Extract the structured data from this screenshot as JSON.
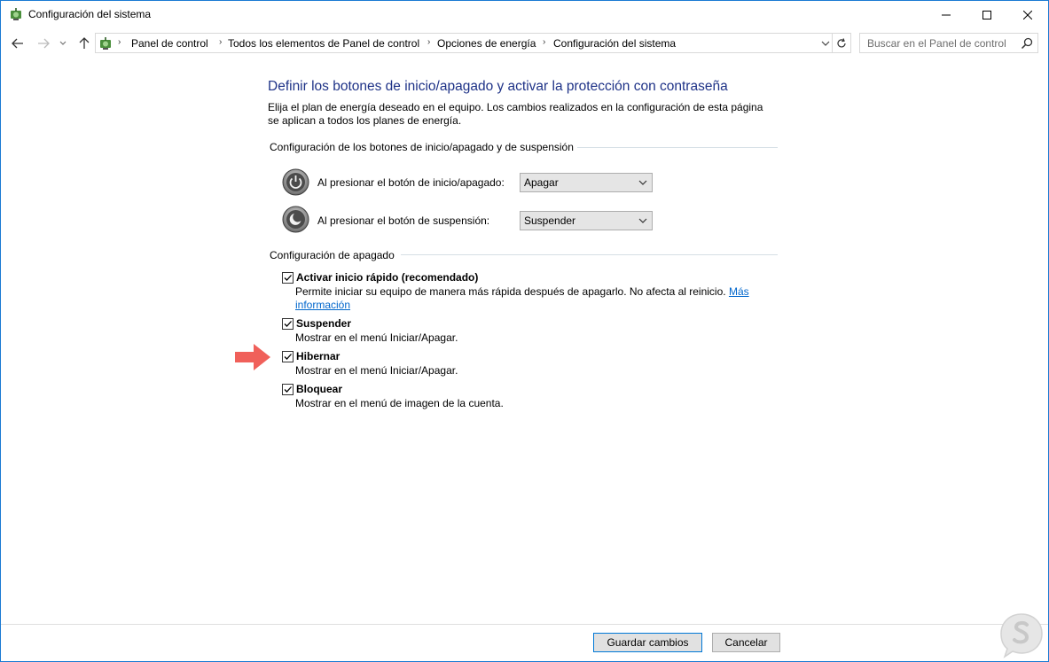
{
  "window": {
    "title": "Configuración del sistema"
  },
  "nav": {
    "breadcrumbs": [
      "Panel de control",
      "Todos los elementos de Panel de control",
      "Opciones de energía",
      "Configuración del sistema"
    ],
    "search_placeholder": "Buscar en el Panel de control"
  },
  "main": {
    "heading": "Definir los botones de inicio/apagado y activar la protección con contraseña",
    "description": "Elija el plan de energía deseado en el equipo. Los cambios realizados en la configuración de esta página se aplican a todos los planes de energía.",
    "buttons_section": {
      "title": "Configuración de los botones de inicio/apagado y de suspensión",
      "power_button_label": "Al presionar el botón de inicio/apagado:",
      "power_button_value": "Apagar",
      "sleep_button_label": "Al presionar el botón de suspensión:",
      "sleep_button_value": "Suspender"
    },
    "shutdown_section": {
      "title": "Configuración de apagado",
      "options": [
        {
          "title": "Activar inicio rápido (recomendado)",
          "checked": true,
          "desc": "Permite iniciar su equipo de manera más rápida después de apagarlo. No afecta al reinicio.",
          "link_part1": "Más",
          "link_part2": "información"
        },
        {
          "title": "Suspender",
          "checked": true,
          "desc": "Mostrar en el menú Iniciar/Apagar."
        },
        {
          "title": "Hibernar",
          "checked": true,
          "desc": "Mostrar en el menú Iniciar/Apagar."
        },
        {
          "title": "Bloquear",
          "checked": true,
          "desc": "Mostrar en el menú de imagen de la cuenta."
        }
      ]
    }
  },
  "footer": {
    "save_label": "Guardar cambios",
    "cancel_label": "Cancelar"
  },
  "colors": {
    "heading": "#1e3287",
    "link": "#0066cc",
    "arrow": "#f0605a",
    "accent": "#0078d7"
  },
  "icons": {
    "app": "control-panel-power-icon",
    "arrow_annotation": "red-arrow-icon",
    "watermark": "logo-watermark-icon"
  }
}
